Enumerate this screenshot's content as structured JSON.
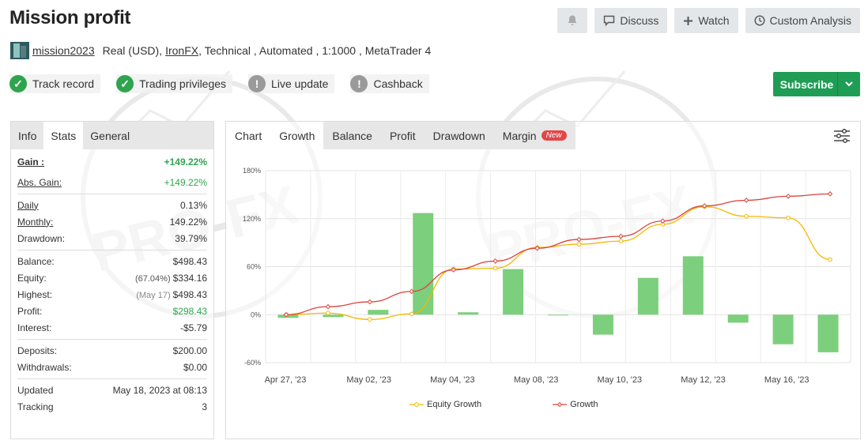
{
  "header": {
    "title": "Mission profit",
    "buttons": {
      "discuss": "Discuss",
      "watch": "Watch",
      "custom_analysis": "Custom Analysis"
    }
  },
  "meta": {
    "username": "mission2023",
    "account_type": "Real (USD),",
    "broker": "IronFX",
    "details": ", Technical , Automated , 1:1000 , MetaTrader 4"
  },
  "badges": [
    {
      "label": "Track record",
      "status": "ok"
    },
    {
      "label": "Trading privileges",
      "status": "ok"
    },
    {
      "label": "Live update",
      "status": "warn"
    },
    {
      "label": "Cashback",
      "status": "warn"
    }
  ],
  "subscribe_label": "Subscribe",
  "left_tabs": [
    "Info",
    "Stats",
    "General"
  ],
  "stats": {
    "gain": {
      "label": "Gain :",
      "value": "+149.22%"
    },
    "abs_gain": {
      "label": "Abs. Gain:",
      "value": "+149.22%"
    },
    "daily": {
      "label": "Daily",
      "value": "0.13%"
    },
    "monthly": {
      "label": "Monthly:",
      "value": "149.22%"
    },
    "drawdown": {
      "label": "Drawdown:",
      "value": "39.79%"
    },
    "balance": {
      "label": "Balance:",
      "value": "$498.43"
    },
    "equity": {
      "label": "Equity:",
      "pre": "(67.04%)",
      "value": "$334.16"
    },
    "highest": {
      "label": "Highest:",
      "pre": "(May 17)",
      "value": "$498.43"
    },
    "profit": {
      "label": "Profit:",
      "value": "$298.43"
    },
    "interest": {
      "label": "Interest:",
      "value": "-$5.79"
    },
    "deposits": {
      "label": "Deposits:",
      "value": "$200.00"
    },
    "withdrawals": {
      "label": "Withdrawals:",
      "value": "$0.00"
    },
    "updated": {
      "label": "Updated",
      "value": "May 18, 2023 at 08:13"
    },
    "tracking": {
      "label": "Tracking",
      "value": "3"
    }
  },
  "chart_tabs": {
    "chart": "Chart",
    "growth": "Growth",
    "balance": "Balance",
    "profit": "Profit",
    "drawdown": "Drawdown",
    "margin": "Margin",
    "new_badge": "New"
  },
  "colors": {
    "accent_green": "#1f9d55",
    "bar_green": "#7ccf7c",
    "equity_line": "#f5b800",
    "growth_line": "#d9443c"
  },
  "chart_data": {
    "type": "bar+line",
    "y_ticks": [
      "180%",
      "120%",
      "60%",
      "0%",
      "-60%"
    ],
    "ylim": [
      -60,
      180
    ],
    "x_tick_labels": [
      "Apr 27, '23",
      "May 02, '23",
      "May 04, '23",
      "May 08, '23",
      "May 10, '23",
      "May 12, '23",
      "May 16, '23"
    ],
    "bar_values": [
      -4,
      -3,
      6,
      127,
      3,
      57,
      0,
      -25,
      46,
      73,
      -10,
      -37,
      -47
    ],
    "series": [
      {
        "name": "Equity Growth",
        "color": "#f5b800",
        "values": [
          0,
          2,
          -6,
          1,
          57,
          58,
          84,
          88,
          92,
          113,
          135,
          123,
          121,
          69
        ]
      },
      {
        "name": "Growth",
        "color": "#d9443c",
        "values": [
          0,
          10,
          16,
          29,
          56,
          67,
          83,
          94,
          98,
          117,
          136,
          143,
          148,
          151
        ]
      }
    ],
    "grid": true,
    "legend_position": "bottom"
  }
}
